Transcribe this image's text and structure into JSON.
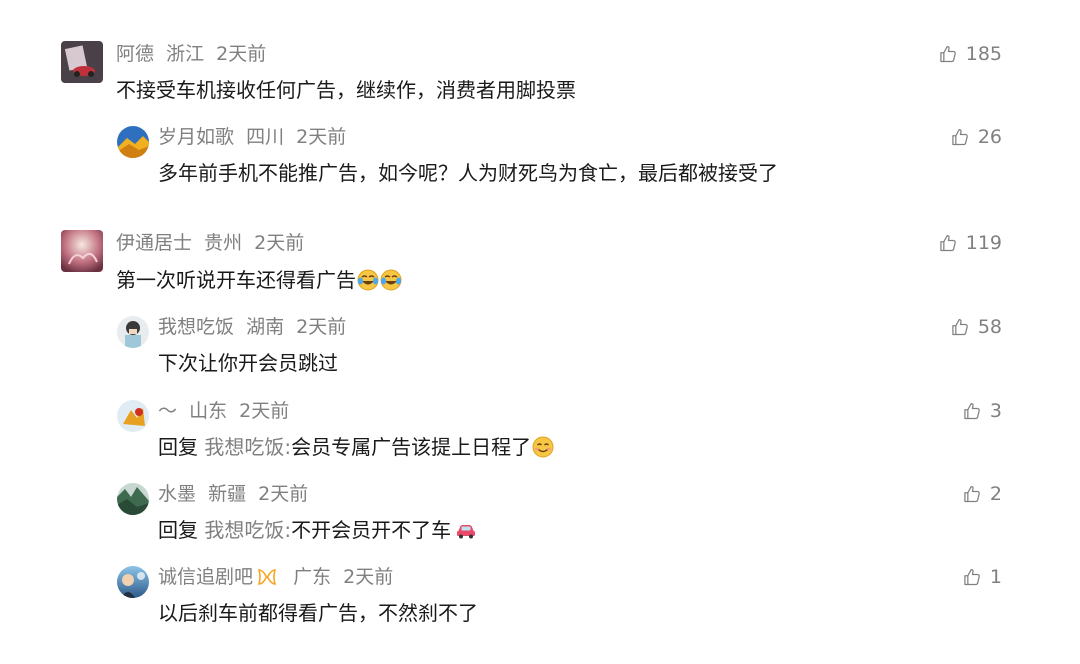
{
  "comments": [
    {
      "user": "阿德",
      "location": "浙江",
      "time": "2天前",
      "text": "不接受车机接收任何广告，继续作，消费者用脚投票",
      "likes": "185",
      "replies": [
        {
          "user": "岁月如歌",
          "location": "四川",
          "time": "2天前",
          "text": "多年前手机不能推广告，如今呢？人为财死鸟为食亡，最后都被接受了",
          "likes": "26"
        }
      ]
    },
    {
      "user": "伊通居士",
      "location": "贵州",
      "time": "2天前",
      "text": "第一次听说开车还得看广告",
      "emoji": [
        "laugh-cry-emoji",
        "laugh-cry-emoji"
      ],
      "likes": "119",
      "replies": [
        {
          "user": "我想吃饭",
          "location": "湖南",
          "time": "2天前",
          "text": "下次让你开会员跳过",
          "likes": "58"
        },
        {
          "user": "～",
          "location": "山东",
          "time": "2天前",
          "reply_prefix": "回复",
          "reply_target": "我想吃饭:",
          "text": "会员专属广告该提上日程了",
          "emoji": [
            "smile-emoji"
          ],
          "likes": "3"
        },
        {
          "user": "水墨",
          "location": "新疆",
          "time": "2天前",
          "reply_prefix": "回复",
          "reply_target": "我想吃饭:",
          "text": "不开会员开不了车",
          "emoji": [
            "car-emoji"
          ],
          "likes": "2"
        },
        {
          "user": "诚信追剧吧",
          "badge": "fan-badge-icon",
          "location": "广东",
          "time": "2天前",
          "text": "以后刹车前都得看广告，不然刹不了",
          "likes": "1"
        }
      ]
    }
  ],
  "colors": {
    "meta": "#808080",
    "text": "#1a1a1a",
    "badge": "#f5a623"
  }
}
